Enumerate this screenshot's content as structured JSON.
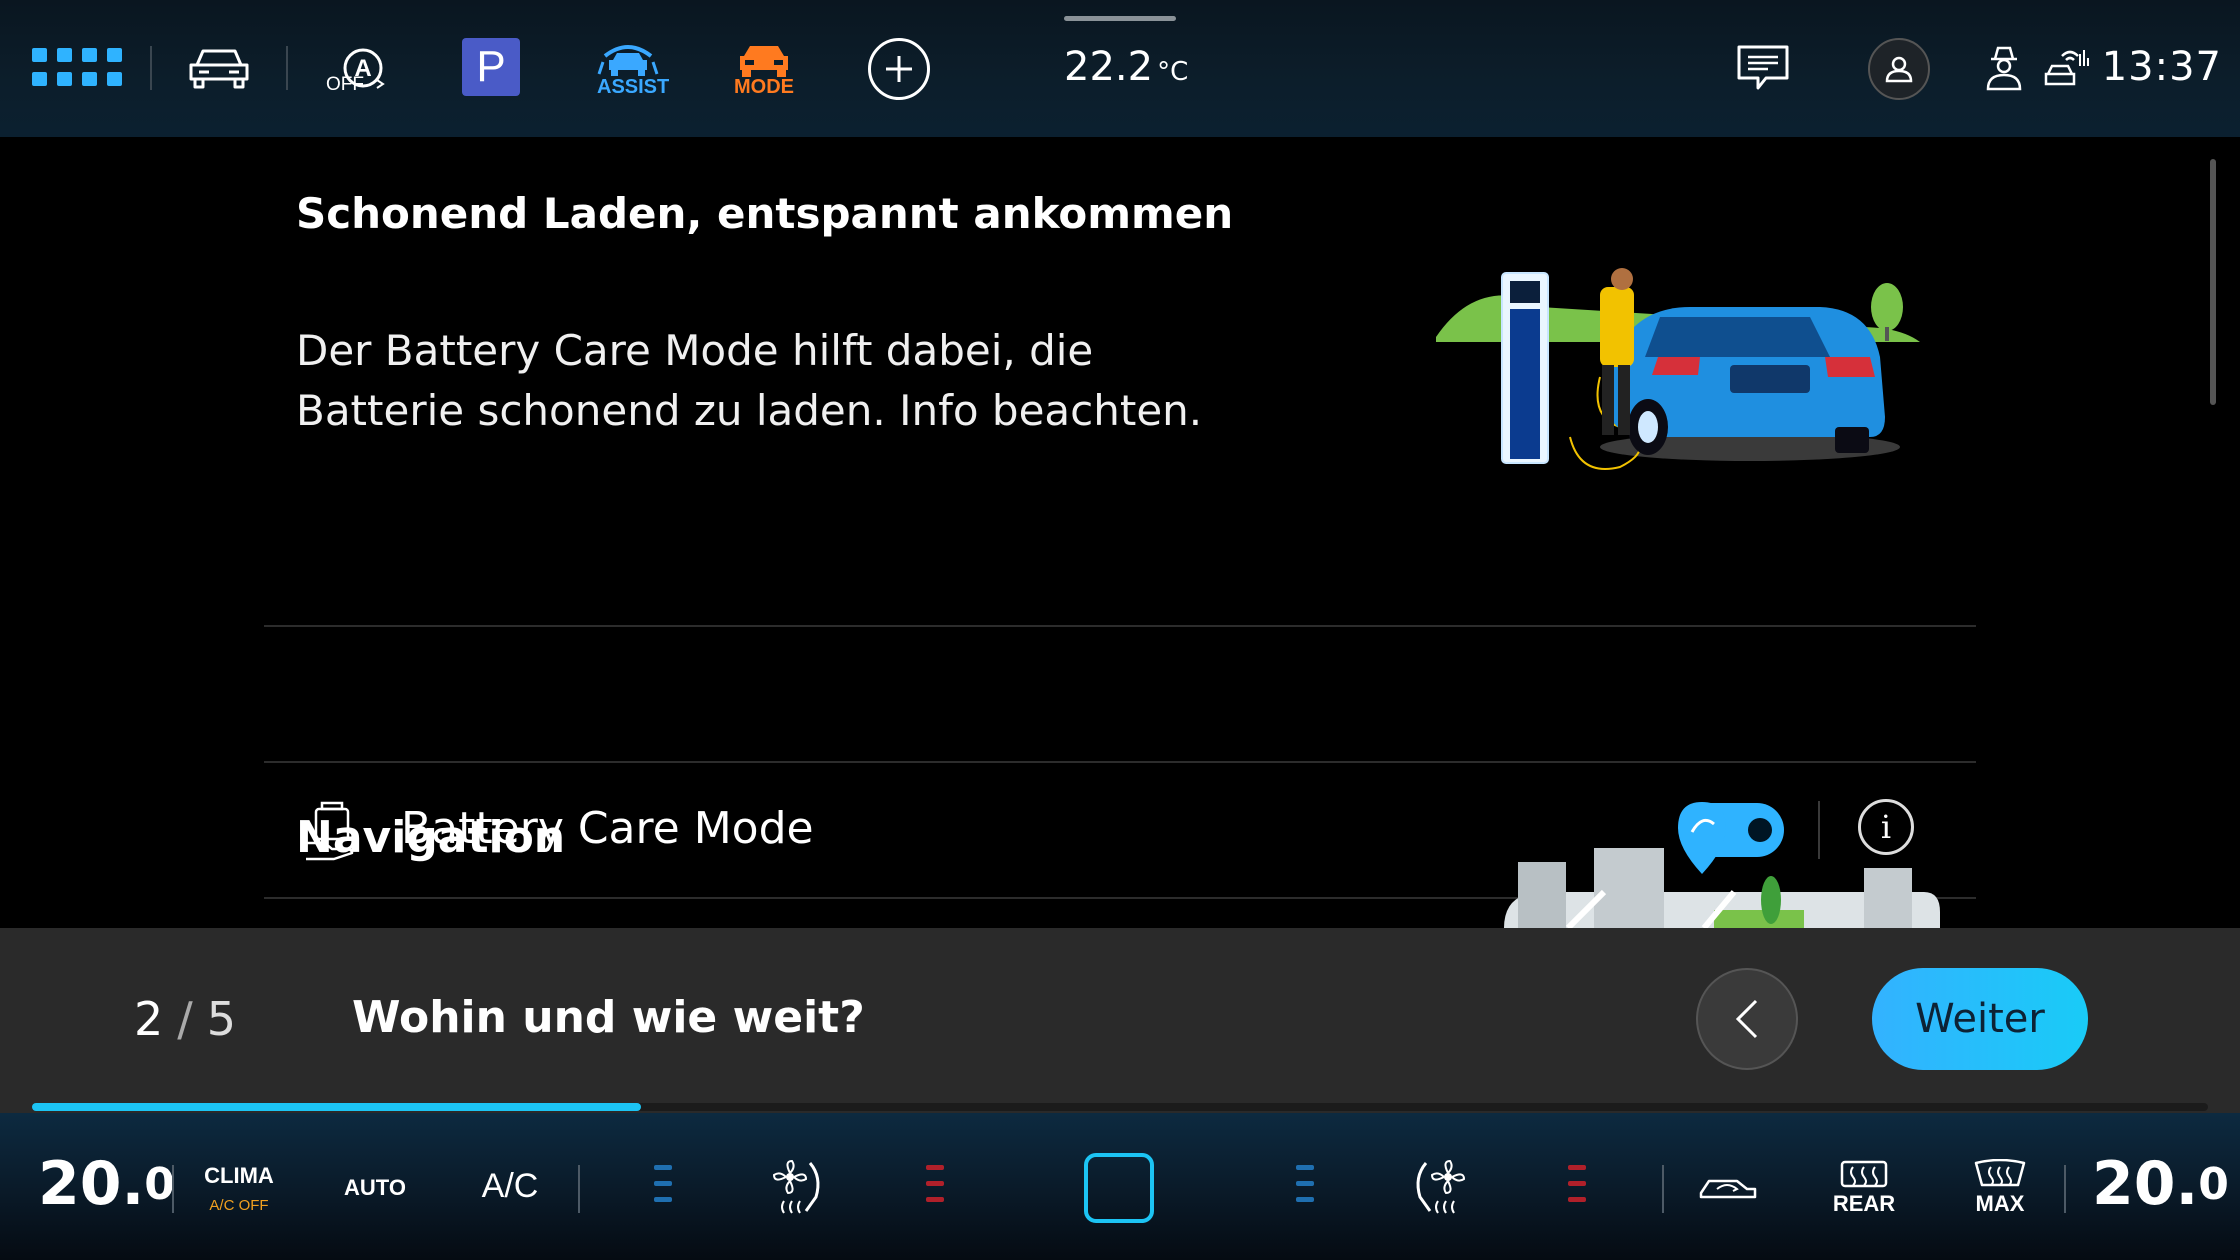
{
  "status_bar": {
    "outside_temp_value": "22.2",
    "outside_temp_unit": "°C",
    "clock": "13:37",
    "parking_label": "P",
    "auto_hold_label": "OFF",
    "assist_label": "ASSIST",
    "mode_label": "MODE",
    "colors": {
      "assist": "#3aa8ff",
      "mode": "#ff7a1f",
      "parking_bg": "#4a5bc7"
    }
  },
  "content": {
    "headline": "Schonend Laden, entspannt ankommen",
    "description": "Der Battery Care Mode hilft dabei, die Batterie schonend zu laden. Info beachten.",
    "battery_care": {
      "label": "Battery Care Mode",
      "enabled": true
    },
    "navigation_section": {
      "title": "Navigation"
    }
  },
  "tour": {
    "current_step": "2",
    "separator": "/",
    "total_steps": "5",
    "title": "Wohin und wie weit?",
    "next_label": "Weiter",
    "progress_fraction": 0.28
  },
  "climate": {
    "left_temp_int": "20.",
    "left_temp_dec": "0",
    "right_temp_int": "20.",
    "right_temp_dec": "0",
    "clima_label": "CLIMA",
    "ac_off_label": "A/C OFF",
    "auto_label": "AUTO",
    "ac_label": "A/C",
    "rear_label": "REAR",
    "max_label": "MAX",
    "colors": {
      "accent": "#1cc4f4",
      "ac_off": "#f0a020",
      "heat": "#b0202a",
      "cool": "#1f6fb0"
    }
  }
}
